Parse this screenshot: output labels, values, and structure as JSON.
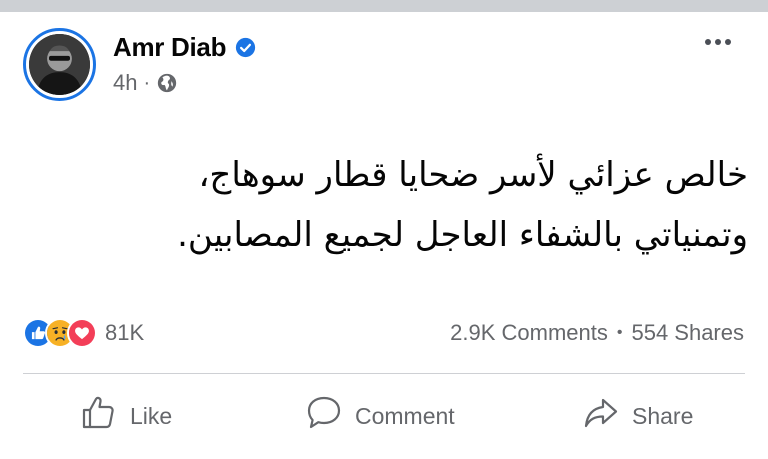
{
  "post": {
    "author": "Amr Diab",
    "verified_icon": "verified-badge-icon",
    "time": "4h",
    "separator": "·",
    "privacy_icon": "globe-icon",
    "text_lines": [
      "خالص عزائي لأسر ضحايا قطار سوهاج،",
      "وتمنياتي بالشفاء العاجل لجميع المصابين."
    ]
  },
  "reactions": {
    "icons": [
      "like-reaction-icon",
      "sad-reaction-icon",
      "love-reaction-icon"
    ],
    "count": "81K"
  },
  "stats": {
    "comments": "2.9K Comments",
    "separator": "•",
    "shares": "554 Shares"
  },
  "actions": {
    "like": "Like",
    "comment": "Comment",
    "share": "Share"
  },
  "colors": {
    "brand_blue": "#1b74e4",
    "secondary_text": "#65676b",
    "love_red": "#f33e58",
    "sad_yellow": "#f7b125"
  }
}
